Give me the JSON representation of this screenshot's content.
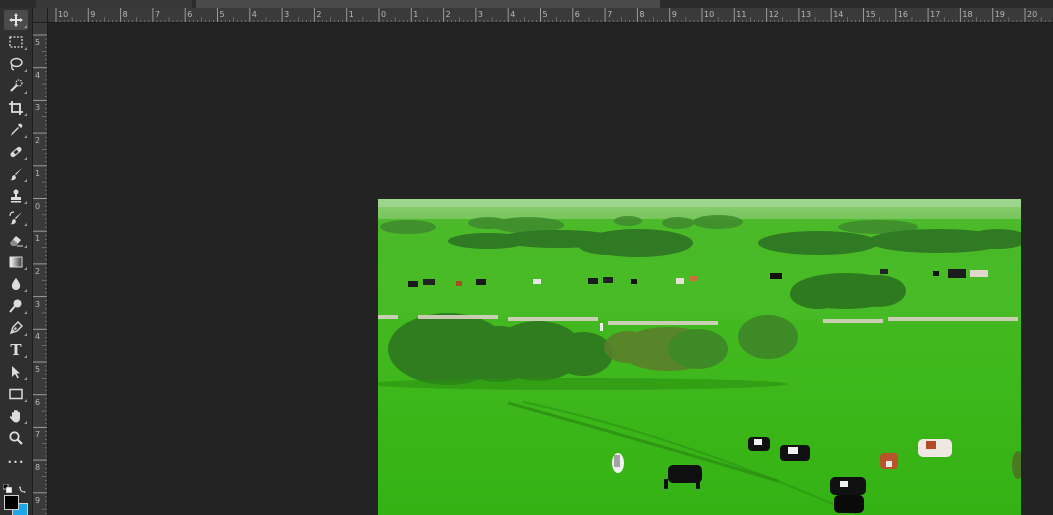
{
  "tabs": [
    {
      "label": ""
    },
    {
      "label": ""
    }
  ],
  "toolbar": {
    "tools": [
      {
        "name": "move-tool",
        "icon": "move-icon",
        "selected": true
      },
      {
        "name": "marquee-tool",
        "icon": "rect-marquee-icon"
      },
      {
        "name": "lasso-tool",
        "icon": "lasso-icon"
      },
      {
        "name": "quick-select-tool",
        "icon": "quick-select-icon"
      },
      {
        "name": "crop-tool",
        "icon": "crop-icon"
      },
      {
        "name": "eyedropper-tool",
        "icon": "eyedropper-icon"
      },
      {
        "name": "healing-brush-tool",
        "icon": "bandage-icon"
      },
      {
        "name": "brush-tool",
        "icon": "brush-icon"
      },
      {
        "name": "clone-stamp-tool",
        "icon": "stamp-icon"
      },
      {
        "name": "history-brush-tool",
        "icon": "history-brush-icon"
      },
      {
        "name": "eraser-tool",
        "icon": "eraser-icon"
      },
      {
        "name": "gradient-tool",
        "icon": "gradient-icon"
      },
      {
        "name": "blur-tool",
        "icon": "drop-icon"
      },
      {
        "name": "dodge-tool",
        "icon": "dodge-icon"
      },
      {
        "name": "pen-tool",
        "icon": "pen-icon"
      },
      {
        "name": "type-tool",
        "icon": "type-icon",
        "glyph": "T"
      },
      {
        "name": "path-select-tool",
        "icon": "arrow-icon"
      },
      {
        "name": "shape-tool",
        "icon": "rectangle-icon"
      },
      {
        "name": "hand-tool",
        "icon": "hand-icon"
      },
      {
        "name": "zoom-tool",
        "icon": "magnifier-icon"
      },
      {
        "name": "edit-toolbar",
        "icon": "ellipsis-icon",
        "glyph": "•••"
      }
    ],
    "foreground_color": "#000000",
    "background_color": "#1ea7e9"
  },
  "rulers": {
    "horizontal": [
      "10",
      "9",
      "8",
      "7",
      "6",
      "5",
      "4",
      "3",
      "2",
      "1",
      "0",
      "1",
      "2",
      "3",
      "4",
      "5",
      "6",
      "7",
      "8",
      "9",
      "10",
      "11",
      "12",
      "13",
      "14",
      "15",
      "16",
      "17",
      "18",
      "19",
      "20"
    ],
    "vertical": [
      "5",
      "4",
      "3",
      "2",
      "1",
      "0",
      "1",
      "2",
      "3",
      "4",
      "5",
      "6",
      "7",
      "8",
      "9"
    ]
  },
  "colors": {
    "app_background": "#232323",
    "toolbar": "#2f2f2f",
    "ruler": "#3a3a3a",
    "grass": "#3cb81e",
    "tree": "#2f7d1f"
  }
}
